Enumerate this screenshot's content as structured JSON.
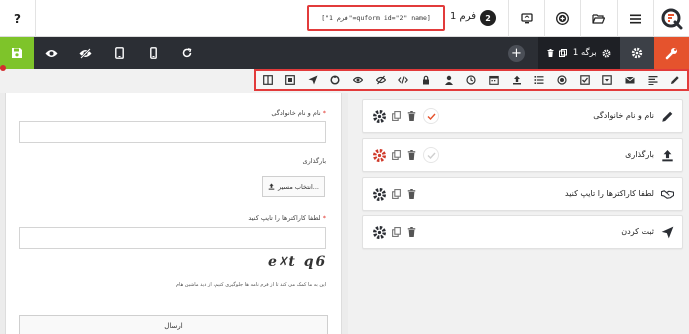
{
  "topbar": {
    "help_label": "?",
    "shortcode": "[\"1 فرم\"=quform id=\"2\" name]",
    "form_label": "فرم 1",
    "form_count": "2"
  },
  "darkbar": {
    "page_label": "برگه 1"
  },
  "preview": {
    "field1_label": "نام و نام خانوادگی",
    "field1_required": "*",
    "field2_label": "بارگذاری",
    "upload_button": "انتخاب مسیر...",
    "field3_label": "لطفا کاراکترها را تایپ کنید",
    "field3_required": "*",
    "captcha_text": "e☓t q6",
    "captcha_hint": "این به ما کمک می کند تا از فرم نامه ها جلوگیری کنیم، از دید ماشین هام",
    "submit_label": "ارسال"
  },
  "fields": [
    {
      "label": "نام و نام خانوادگی",
      "icon": "pencil-icon"
    },
    {
      "label": "بارگذاری",
      "icon": "upload-icon"
    },
    {
      "label": "لطفا کاراکترها را تایپ کنید",
      "icon": "handshake-icon"
    },
    {
      "label": "ثبت کردن",
      "icon": "paper-plane-icon"
    }
  ],
  "colors": {
    "save_green": "#7ec42a",
    "tools_orange": "#e5532d",
    "dark_bar": "#2b2e34",
    "highlight_red": "#e23b3b"
  }
}
